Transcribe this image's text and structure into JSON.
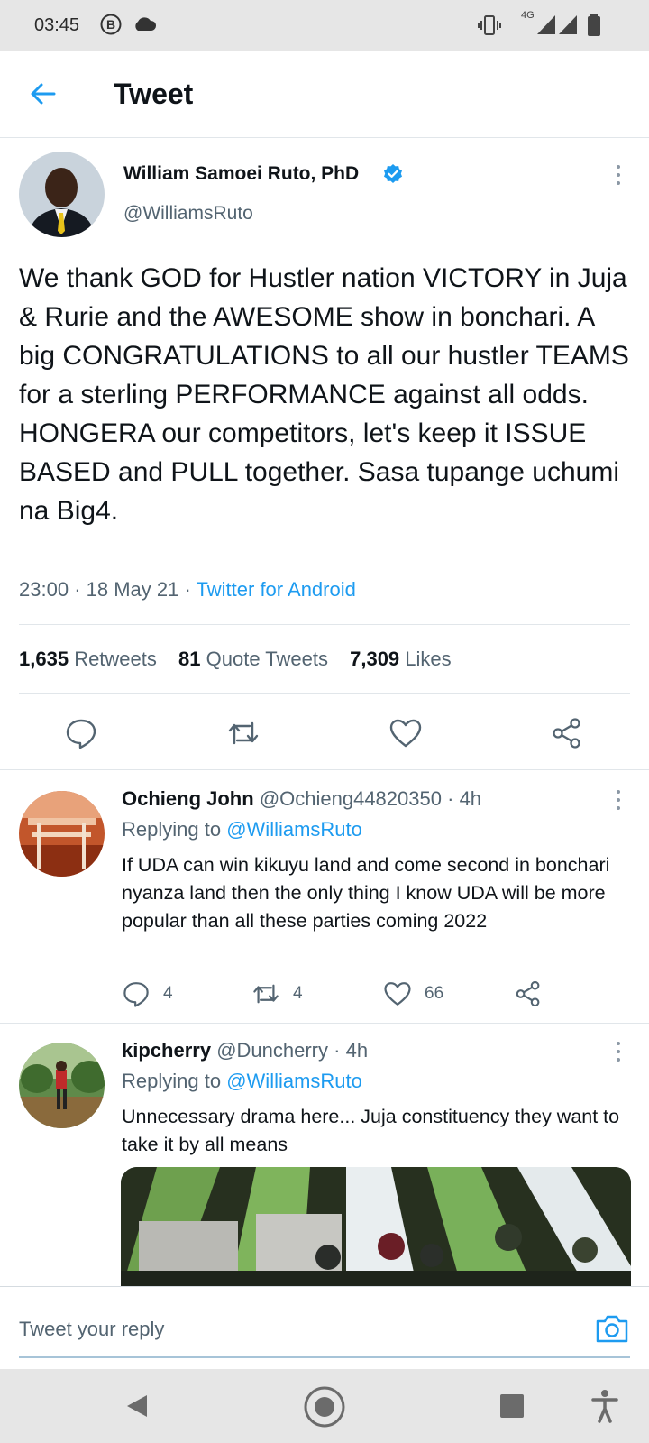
{
  "status_bar": {
    "time": "03:45",
    "network": "4G",
    "icons": [
      "b-circle-icon",
      "cloud-icon",
      "vibrate-icon",
      "signal-icon",
      "signal-icon",
      "battery-icon"
    ]
  },
  "header": {
    "back_icon": "arrow-left-icon",
    "title": "Tweet"
  },
  "tweet": {
    "author_name": "William Samoei Ruto, PhD",
    "verified": true,
    "handle": "@WilliamsRuto",
    "text": "We thank GOD for Hustler nation VICTORY in Juja & Rurie and the AWESOME show in bonchari. A big CONGRATULATIONS to all our hustler TEAMS for a sterling PERFORMANCE against all odds. HONGERA our competitors, let's keep it ISSUE BASED and PULL together. Sasa tupange uchumi na Big4.",
    "time": "23:00",
    "date": "18 May 21",
    "source": "Twitter for Android",
    "retweets_count": "1,635",
    "retweets_label": "Retweets",
    "quotes_count": "81",
    "quotes_label": "Quote Tweets",
    "likes_count": "7,309",
    "likes_label": "Likes",
    "actions": [
      "reply-icon",
      "retweet-icon",
      "like-icon",
      "share-icon"
    ]
  },
  "replies": [
    {
      "name": "Ochieng John",
      "handle": "@Ochieng44820350",
      "age": "4h",
      "replying_label": "Replying to",
      "replying_to": "@WilliamsRuto",
      "text": "If UDA can win kikuyu land and come second in bonchari nyanza land then the only thing I know UDA will be more popular than all these parties coming 2022",
      "reply_count": "4",
      "retweet_count": "4",
      "like_count": "66"
    },
    {
      "name": "kipcherry",
      "handle": "@Duncherry",
      "age": "4h",
      "replying_label": "Replying to",
      "replying_to": "@WilliamsRuto",
      "text": "Unnecessary drama here... Juja constituency they want to take it by all means"
    }
  ],
  "composer": {
    "placeholder": "Tweet your reply",
    "camera_icon": "camera-icon"
  },
  "nav_bar": {
    "icons": [
      "back-triangle-icon",
      "home-circle-icon",
      "recents-square-icon",
      "accessibility-icon"
    ]
  },
  "colors": {
    "accent": "#1d9bf0",
    "text": "#0f1419",
    "secondary": "#536471",
    "divider": "#e1e6ea"
  }
}
